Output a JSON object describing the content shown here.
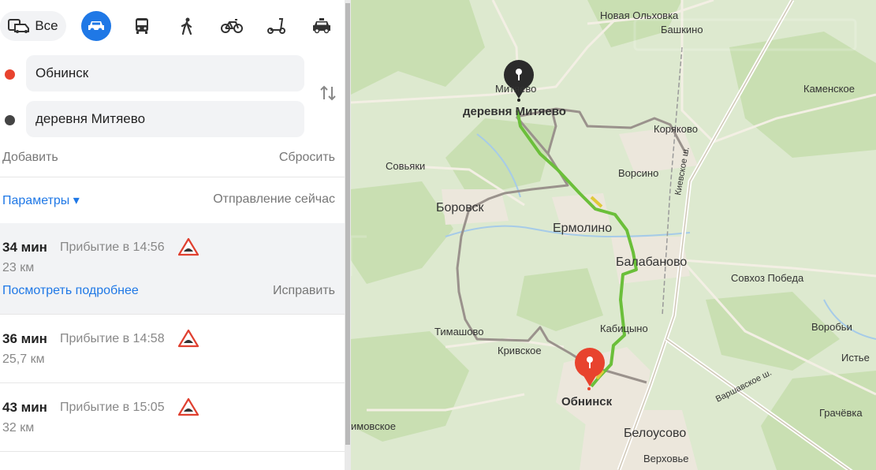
{
  "transport_modes": {
    "all_label": "Все",
    "icons": [
      "car-bus-icon",
      "car-icon",
      "bus-icon",
      "pedestrian-icon",
      "bicycle-icon",
      "scooter-icon",
      "taxi-icon"
    ],
    "active": "car-icon"
  },
  "route_form": {
    "from": "Обнинск",
    "to": "деревня Митяево",
    "add_label": "Добавить",
    "reset_label": "Сбросить",
    "params_label": "Параметры ▾",
    "departure_label": "Отправление сейчас"
  },
  "routes": [
    {
      "time": "34 мин",
      "arrival": "Прибытие в 14:56",
      "distance": "23 км",
      "details_label": "Посмотреть подробнее",
      "fix_label": "Исправить"
    },
    {
      "time": "36 мин",
      "arrival": "Прибытие в 14:58",
      "distance": "25,7 км"
    },
    {
      "time": "43 мин",
      "arrival": "Прибытие в 15:05",
      "distance": "32 км"
    }
  ],
  "map": {
    "labels": {
      "nova_olkhovka": "Новая Ольховка",
      "bashkino": "Башкино",
      "mityaevo_small": "Митяево",
      "mityaevo_village": "деревня Митяево",
      "kamenskoe": "Каменское",
      "koryakovo": "Коряково",
      "sovyaki": "Совьяки",
      "vorsino": "Ворсино",
      "kievskoe": "Киевское ш.",
      "borovsk": "Боровск",
      "ermolino": "Ермолино",
      "balabanovo": "Балабаново",
      "sovkhoz_pobeda": "Совхоз Победа",
      "timashovo": "Тимашово",
      "kabitsyno": "Кабицыно",
      "vorobyi": "Воробьи",
      "krivskoe": "Кривское",
      "istie": "Истье",
      "obninsk": "Обнинск",
      "varshavskoe": "Варшавское ш.",
      "grachyovka": "Грачёвка",
      "imovskoe": "имовское",
      "belousovo": "Белоусово",
      "verkhovye": "Верховье"
    },
    "colors": {
      "route_main": "#6bbf3a",
      "route_alt": "#9a928c",
      "pin_start": "#e8432e",
      "pin_end": "#2b2b2b"
    }
  }
}
